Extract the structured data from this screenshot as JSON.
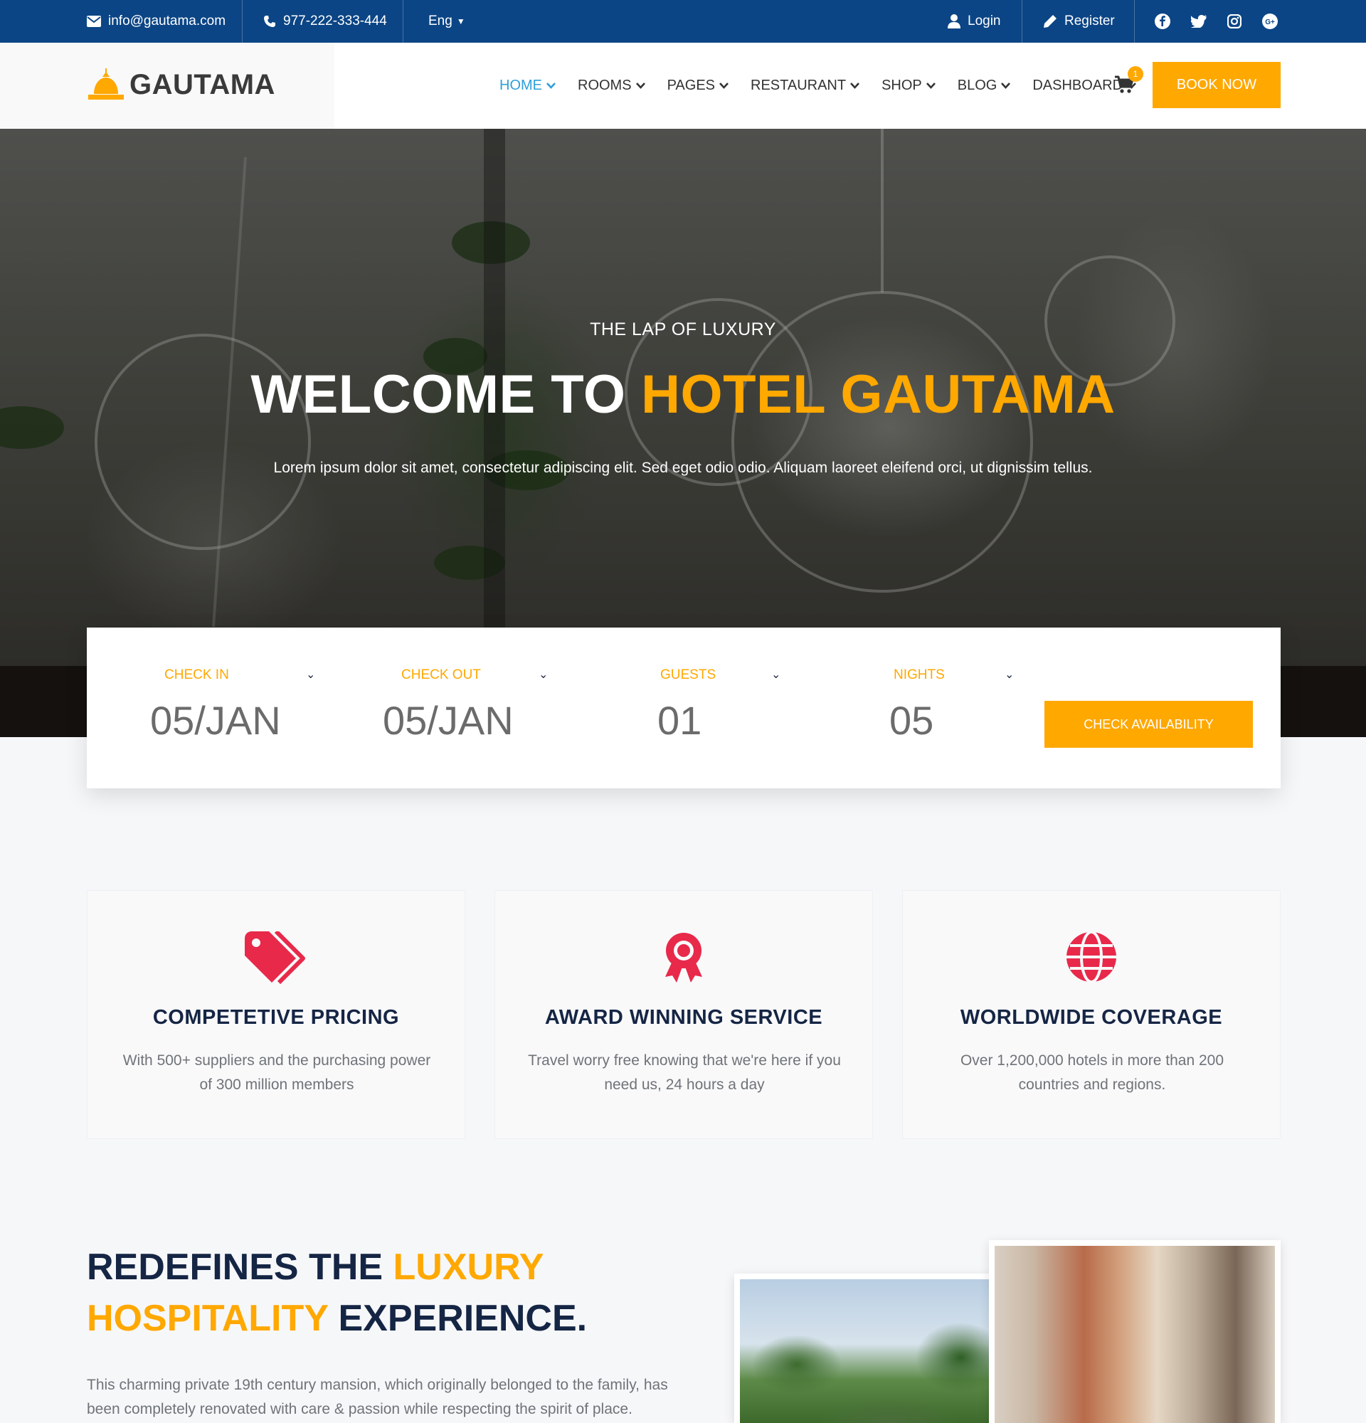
{
  "topbar": {
    "email": "info@gautama.com",
    "phone": "977-222-333-444",
    "language": "Eng",
    "login": "Login",
    "register": "Register",
    "social_icons": [
      "facebook-icon",
      "twitter-icon",
      "instagram-icon",
      "google-plus-icon"
    ]
  },
  "header": {
    "logo": "GAUTAMA",
    "nav": [
      "HOME",
      "ROOMS",
      "PAGES",
      "RESTAURANT",
      "SHOP",
      "BLOG",
      "DASHBOARD"
    ],
    "active_nav": "HOME",
    "cart_count": "1",
    "book_now": "BOOK NOW"
  },
  "hero": {
    "subtitle": "THE LAP OF LUXURY",
    "title_white": "WELCOME TO",
    "title_accent": "HOTEL GAUTAMA",
    "description": "Lorem ipsum dolor sit amet, consectetur adipiscing elit. Sed eget odio odio. Aliquam laoreet eleifend orci, ut dignissim tellus."
  },
  "booking": {
    "fields": [
      {
        "label": "CHECK IN",
        "value": "05/JAN"
      },
      {
        "label": "CHECK OUT",
        "value": "05/JAN"
      },
      {
        "label": "GUESTS",
        "value": "01"
      },
      {
        "label": "NIGHTS",
        "value": "05"
      }
    ],
    "button": "CHECK AVAILABILITY"
  },
  "features": [
    {
      "icon": "price-tag-icon",
      "title": "COMPETETIVE PRICING",
      "description": "With 500+ suppliers and the purchasing power of 300 million members"
    },
    {
      "icon": "award-ribbon-icon",
      "title": "AWARD WINNING SERVICE",
      "description": "Travel worry free knowing that we're here if you need us, 24 hours a day"
    },
    {
      "icon": "globe-icon",
      "title": "WORLDWIDE COVERAGE",
      "description": "Over 1,200,000 hotels in more than 200 countries and regions."
    }
  ],
  "about": {
    "title_part1": "REDEFINES THE",
    "title_accent1": "LUXURY",
    "title_accent2": "HOSPITALITY",
    "title_part2": "EXPERIENCE.",
    "description": "This charming private 19th century mansion, which originally belonged to the family, has been completely renovated with care & passion while respecting the spirit of place."
  },
  "colors": {
    "topbar": "#0b4585",
    "accent": "#ffa800",
    "nav_active": "#2e9fd9",
    "feature_icon": "#e8294a",
    "heading": "#152544"
  }
}
